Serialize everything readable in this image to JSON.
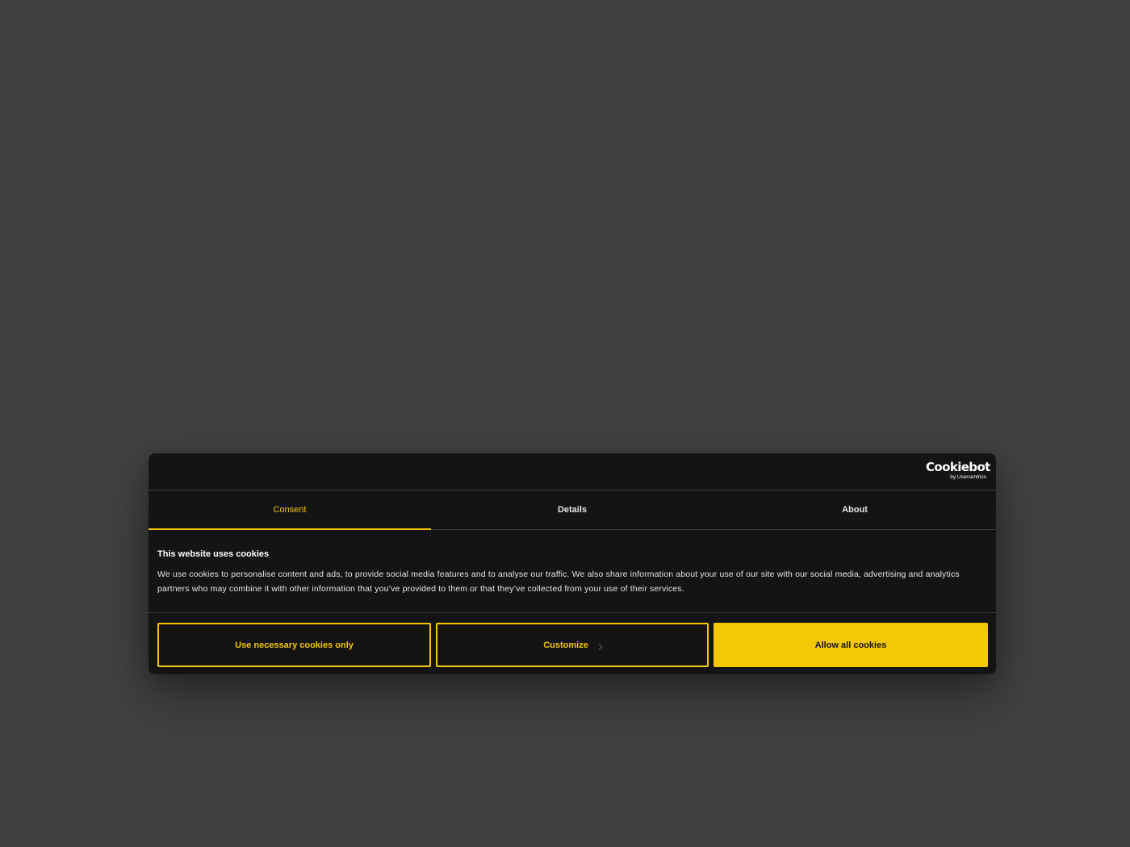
{
  "logo": {
    "main": "Cookiebot",
    "sub": "by Usercentrics"
  },
  "tabs": [
    {
      "label": "Consent",
      "active": true
    },
    {
      "label": "Details",
      "active": false
    },
    {
      "label": "About",
      "active": false
    }
  ],
  "consent": {
    "title": "This website uses cookies",
    "text": "We use cookies to personalise content and ads, to provide social media features and to analyse our traffic. We also share information about your use of our site with our social media, advertising and analytics partners who may combine it with other information that you’ve provided to them or that they’ve collected from your use of their services."
  },
  "buttons": {
    "necessary_label": "Use necessary cookies only",
    "customize_label": "Customize",
    "allow_label": "Allow all cookies"
  },
  "colors": {
    "accent": "#f4c805",
    "dialog_bg": "#141414",
    "backdrop": "#414141"
  },
  "icons": {
    "customize": "chevron-right-icon"
  }
}
